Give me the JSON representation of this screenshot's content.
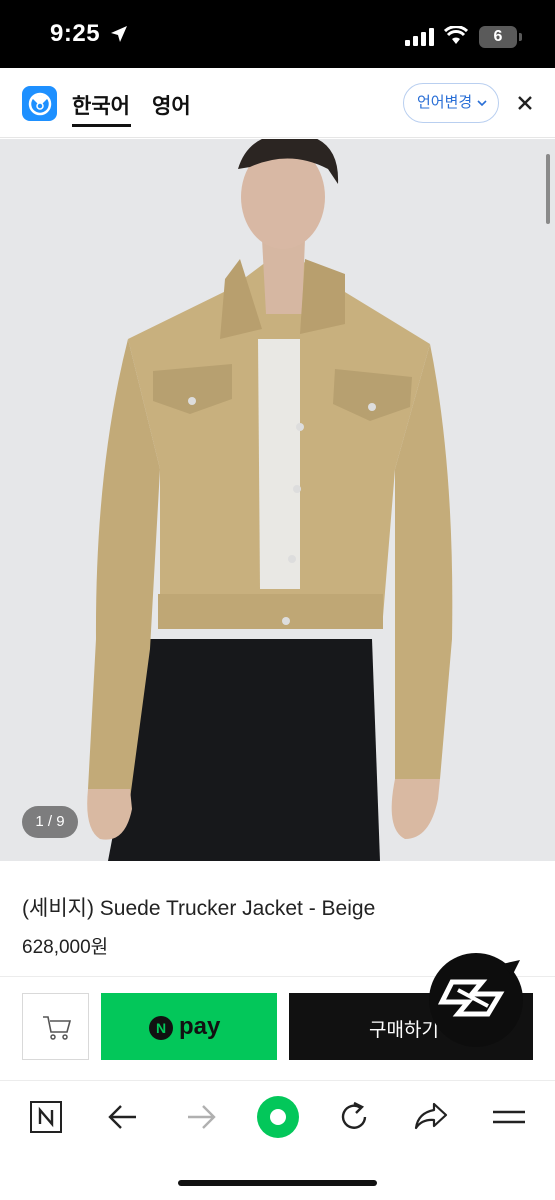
{
  "status_bar": {
    "time": "9:25",
    "battery": "6"
  },
  "translate_bar": {
    "tabs": [
      {
        "label": "한국어",
        "active": true
      },
      {
        "label": "영어",
        "active": false
      }
    ],
    "change_language": "언어변경"
  },
  "gallery": {
    "counter": "1 / 9"
  },
  "product": {
    "title": "(세비지) Suede Trucker Jacket - Beige",
    "price": "628,000원"
  },
  "actions": {
    "npay_letter": "N",
    "npay_label": "pay",
    "buy_label": "구매하기"
  },
  "toolbar": {
    "icons": [
      "naver-n-icon",
      "back-arrow-icon",
      "forward-arrow-icon",
      "green-dot-icon",
      "refresh-icon",
      "share-icon",
      "menu-icon"
    ]
  },
  "colors": {
    "npay_green": "#03c75a",
    "papago_blue": "#1e90ff",
    "link_blue": "#2a6fd6"
  }
}
